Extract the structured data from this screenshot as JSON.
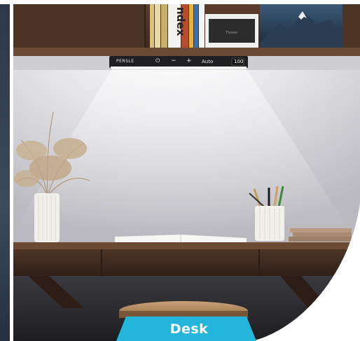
{
  "lamp": {
    "brand": "PERSLE",
    "power_symbol": "⏻",
    "minus_symbol": "−",
    "plus_symbol": "+",
    "mode": "Auto",
    "level": "100"
  },
  "books": {
    "spine_text": "ndex",
    "box_text": "Flower"
  },
  "caption": {
    "label": "Desk",
    "bg_color": "#23b5dc"
  },
  "colors": {
    "wall": "#e3e3e6",
    "wood": "#5a3f2e",
    "lamp_bar": "#1f1f22"
  }
}
